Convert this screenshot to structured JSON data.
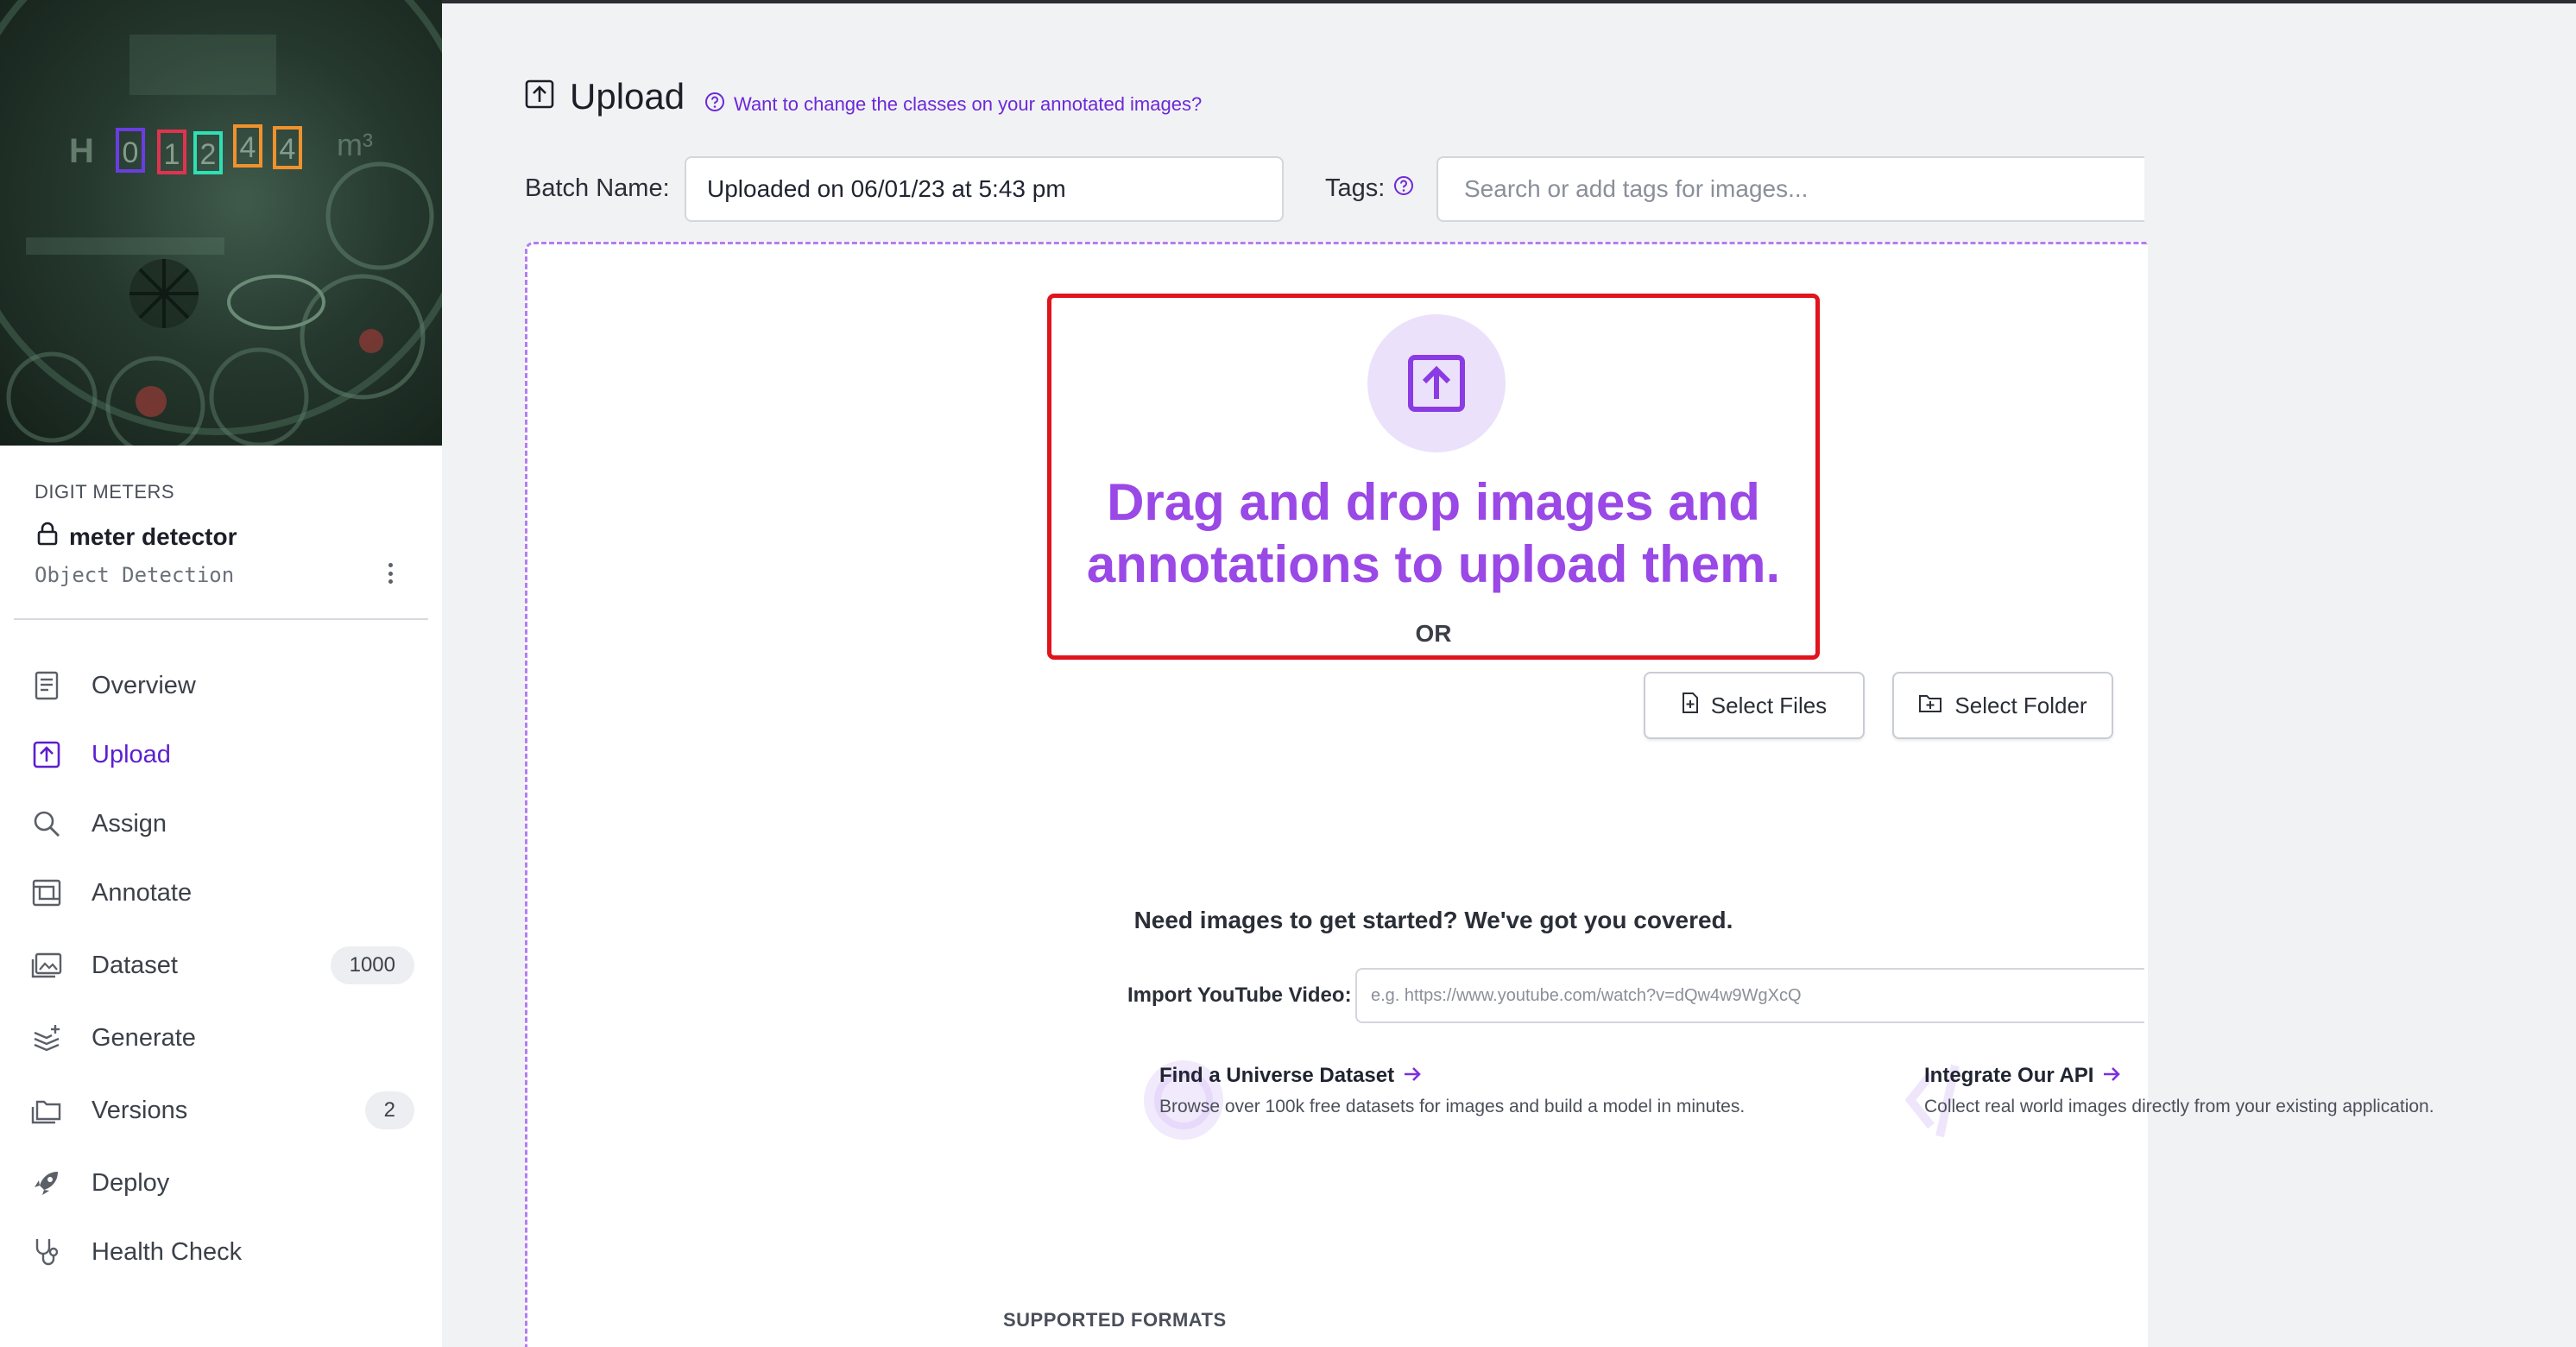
{
  "sidebar": {
    "project_group": "DIGIT METERS",
    "project_name": "meter detector",
    "project_type": "Object Detection",
    "thumbnail_digits": [
      "0",
      "1",
      "2",
      "4",
      "4"
    ],
    "nav": [
      {
        "label": "Overview",
        "icon": "document-icon"
      },
      {
        "label": "Upload",
        "icon": "upload-icon",
        "active": true
      },
      {
        "label": "Assign",
        "icon": "search-icon"
      },
      {
        "label": "Annotate",
        "icon": "annotate-icon"
      },
      {
        "label": "Dataset",
        "icon": "images-icon",
        "badge": "1000"
      },
      {
        "label": "Generate",
        "icon": "generate-icon"
      },
      {
        "label": "Versions",
        "icon": "folders-icon",
        "badge": "2"
      },
      {
        "label": "Deploy",
        "icon": "rocket-icon"
      },
      {
        "label": "Health Check",
        "icon": "stethoscope-icon"
      }
    ]
  },
  "main": {
    "title": "Upload",
    "help_link": "Want to change the classes on your annotated images?",
    "batch_label": "Batch Name:",
    "batch_value": "Uploaded on 06/01/23 at 5:43 pm",
    "tags_label": "Tags:",
    "tags_placeholder": "Search or add tags for images...",
    "drop_text": "Drag and drop images and annotations to upload them.",
    "or_text": "OR",
    "select_files": "Select Files",
    "select_folder": "Select Folder",
    "need_images": "Need images to get started? We've got you covered.",
    "youtube_label": "Import YouTube Video:",
    "youtube_placeholder": "e.g. https://www.youtube.com/watch?v=dQw4w9WgXcQ",
    "universe_title": "Find a Universe Dataset",
    "universe_desc": "Browse over 100k free datasets for images and build a model in minutes.",
    "api_title": "Integrate Our API",
    "api_desc": "Collect real world images directly from your existing application.",
    "supported_formats": "SUPPORTED FORMATS"
  },
  "colors": {
    "accent": "#9a48e6",
    "active_nav": "#5b1fd0",
    "highlight": "#e0141c",
    "background": "#f1f2f4"
  }
}
